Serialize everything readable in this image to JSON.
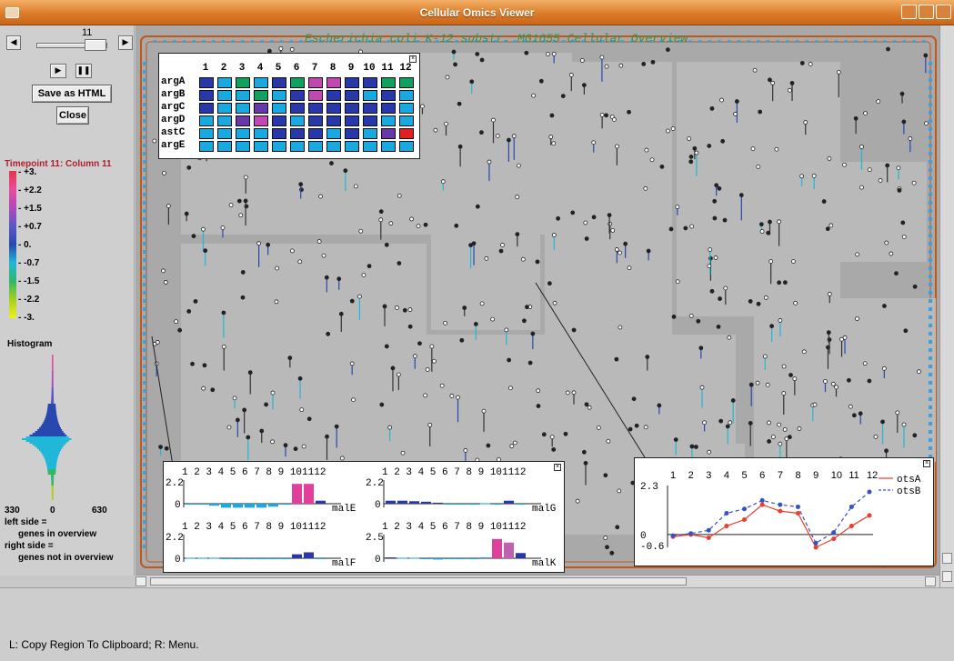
{
  "window": {
    "title": "Cellular Omics Viewer"
  },
  "player": {
    "timepoint_value": "11",
    "save_label": "Save as HTML",
    "close_label": "Close"
  },
  "legend": {
    "title": "Timepoint 11: Column 11",
    "ticks": [
      "+3.",
      "+2.2",
      "+1.5",
      "+0.7",
      "0.",
      "-0.7",
      "-1.5",
      "-2.2",
      "-3."
    ],
    "colors": [
      "#e8344c",
      "#e84c9c",
      "#b04ab8",
      "#5a58c8",
      "#2848b0",
      "#20b8d8",
      "#30b868",
      "#a8d020",
      "#f0f020"
    ]
  },
  "histogram": {
    "title": "Histogram",
    "axis": [
      "330",
      "0",
      "630"
    ],
    "left_note": "left side =",
    "left_note2": "genes in overview",
    "right_note": "right side =",
    "right_note2": "genes not in overview"
  },
  "overview": {
    "title": "Escherichia coli K-12 substr. MG1655 Cellular Overview"
  },
  "heatmap": {
    "columns": [
      "1",
      "2",
      "3",
      "4",
      "5",
      "6",
      "7",
      "8",
      "9",
      "10",
      "11",
      "12"
    ],
    "rows": [
      {
        "gene": "argA",
        "colors": [
          "#2838a8",
          "#1aa8e0",
          "#12a060",
          "#1aa8e0",
          "#2838a8",
          "#12a060",
          "#c048b0",
          "#c048b0",
          "#2838a8",
          "#2838a8",
          "#12a060",
          "#12a060"
        ]
      },
      {
        "gene": "argB",
        "colors": [
          "#2838a8",
          "#1aa8e0",
          "#1aa8e0",
          "#12a060",
          "#1aa8e0",
          "#2838a8",
          "#c048b0",
          "#2838a8",
          "#2838a8",
          "#1aa8e0",
          "#2838a8",
          "#1aa8e0"
        ]
      },
      {
        "gene": "argC",
        "colors": [
          "#2838a8",
          "#1aa8e0",
          "#1aa8e0",
          "#6838a8",
          "#1aa8e0",
          "#2838a8",
          "#2838a8",
          "#2838a8",
          "#2838a8",
          "#2838a8",
          "#2838a8",
          "#1aa8e0"
        ]
      },
      {
        "gene": "argD",
        "colors": [
          "#1aa8e0",
          "#1aa8e0",
          "#6838a8",
          "#c048b0",
          "#2838a8",
          "#1aa8e0",
          "#2838a8",
          "#2838a8",
          "#2838a8",
          "#2838a8",
          "#1aa8e0",
          "#1aa8e0"
        ]
      },
      {
        "gene": "astC",
        "colors": [
          "#1aa8e0",
          "#1aa8e0",
          "#1aa8e0",
          "#1aa8e0",
          "#2838a8",
          "#2838a8",
          "#2838a8",
          "#1aa8e0",
          "#2838a8",
          "#1aa8e0",
          "#6838a8",
          "#e02020"
        ]
      },
      {
        "gene": "argE",
        "colors": [
          "#1aa8e0",
          "#1aa8e0",
          "#1aa8e0",
          "#1aa8e0",
          "#1aa8e0",
          "#1aa8e0",
          "#1aa8e0",
          "#1aa8e0",
          "#1aa8e0",
          "#1aa8e0",
          "#1aa8e0",
          "#1aa8e0"
        ]
      }
    ]
  },
  "bar_charts": {
    "x_labels": "1 2 3 4 5 6 7 8 9 101112",
    "panels": [
      {
        "gene": "malE",
        "ymax": "2.2",
        "values": [
          0,
          0,
          -0.2,
          -0.4,
          -0.4,
          -0.4,
          -0.4,
          -0.3,
          0,
          2.0,
          2.0,
          0.3
        ],
        "colors": [
          "#1aa8e0",
          "#1aa8e0",
          "#1aa8e0",
          "#1aa8e0",
          "#1aa8e0",
          "#1aa8e0",
          "#1aa8e0",
          "#1aa8e0",
          "#1aa8e0",
          "#e0409c",
          "#e0409c",
          "#2838a8"
        ]
      },
      {
        "gene": "malG",
        "ymax": "2.2",
        "values": [
          0.3,
          0.3,
          0.25,
          0.2,
          0.1,
          0,
          0,
          0,
          0.05,
          0,
          0.3,
          0
        ],
        "colors": [
          "#2838a8",
          "#2838a8",
          "#2838a8",
          "#2838a8",
          "#2838a8",
          "#1aa8e0",
          "#1aa8e0",
          "#1aa8e0",
          "#1aa8e0",
          "#1aa8e0",
          "#2838a8",
          "#1aa8e0"
        ]
      },
      {
        "gene": "malF",
        "ymax": "2.2",
        "values": [
          0.05,
          0.05,
          0.05,
          0,
          0,
          0,
          0,
          0,
          0,
          0.4,
          0.6,
          0
        ],
        "colors": [
          "#1aa8e0",
          "#1aa8e0",
          "#1aa8e0",
          "#1aa8e0",
          "#1aa8e0",
          "#1aa8e0",
          "#1aa8e0",
          "#1aa8e0",
          "#1aa8e0",
          "#2838a8",
          "#2838a8",
          "#1aa8e0"
        ]
      },
      {
        "gene": "malK",
        "ymax": "2.5",
        "values": [
          0.1,
          0.05,
          0.05,
          0,
          -0.15,
          0,
          0,
          0,
          0.1,
          2.2,
          1.8,
          0.6
        ],
        "colors": [
          "#2838a8",
          "#1aa8e0",
          "#1aa8e0",
          "#1aa8e0",
          "#1aa8e0",
          "#1aa8e0",
          "#1aa8e0",
          "#1aa8e0",
          "#1aa8e0",
          "#e0409c",
          "#c060b0",
          "#2838a8"
        ]
      }
    ]
  },
  "chart_data": {
    "type": "line",
    "x": [
      1,
      2,
      3,
      4,
      5,
      6,
      7,
      8,
      9,
      10,
      11,
      12
    ],
    "ylim": [
      -0.6,
      2.3
    ],
    "series": [
      {
        "name": "otsA",
        "values": [
          -0.1,
          0,
          -0.15,
          0.4,
          0.7,
          1.4,
          1.1,
          1.0,
          -0.6,
          -0.2,
          0.4,
          0.9
        ],
        "color": "#e84030"
      },
      {
        "name": "otsB",
        "values": [
          -0.05,
          0.05,
          0.2,
          1.0,
          1.2,
          1.6,
          1.4,
          1.3,
          -0.4,
          0.1,
          1.3,
          2.0
        ],
        "color": "#3850c8"
      }
    ],
    "tick_labels": {
      "x": [
        "1",
        "2",
        "3",
        "4",
        "5",
        "6",
        "7",
        "8",
        "9",
        "10",
        "11",
        "12"
      ],
      "y": [
        "2.3",
        "0",
        "-0.6"
      ]
    }
  },
  "status": {
    "text": "L: Copy Region To Clipboard; R: Menu."
  }
}
